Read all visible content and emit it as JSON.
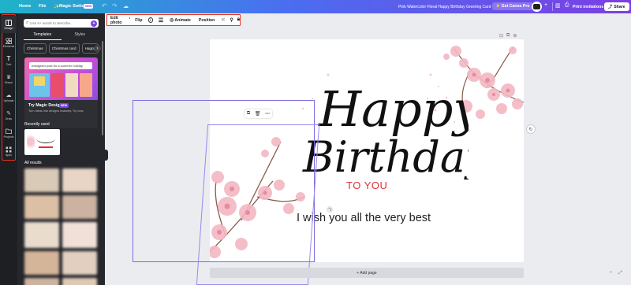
{
  "topbar": {
    "home_label": "Home",
    "file_label": "File",
    "magic_switch_label": "Magic Switch",
    "new_badge": "NEW",
    "doc_title": "Pink Watercolor Floral Happy Birthday Greeting Card",
    "get_pro_label": "Get Canva Pro",
    "print_label": "Print invitations",
    "share_label": "Share"
  },
  "rail": {
    "items": [
      {
        "label": "Design",
        "icon": "layout-icon"
      },
      {
        "label": "Elements",
        "icon": "shapes-icon"
      },
      {
        "label": "Text",
        "icon": "text-icon"
      },
      {
        "label": "Brand",
        "icon": "crown-icon"
      },
      {
        "label": "Uploads",
        "icon": "upload-icon"
      },
      {
        "label": "Draw",
        "icon": "pen-icon"
      },
      {
        "label": "Projects",
        "icon": "folder-icon"
      },
      {
        "label": "Apps",
        "icon": "apps-icon"
      }
    ]
  },
  "panel": {
    "search_placeholder": "Use 5+ words to describe...",
    "tab_templates": "Templates",
    "tab_styles": "Styles",
    "chips": [
      "Christmas",
      "Christmas card",
      "Happy"
    ],
    "promo_input": "Instagram post for a summer holiday",
    "promo_title": "Try Magic Design",
    "promo_badge": "NEW",
    "promo_desc": "Turn ideas into designs instantly. Try now.",
    "recently_used": "Recently used",
    "all_results": "All results"
  },
  "toolbar": {
    "edit_photo": "Edit photo",
    "flip": "Flip",
    "animate": "Animate",
    "position": "Position"
  },
  "canvas": {
    "happy": "Happy",
    "birthday": "Birthday",
    "to_you": "TO YOU",
    "wish": "I wish you all the very best",
    "add_page": "+ Add page"
  },
  "colors": {
    "accent_red": "#e8341f",
    "to_you_red": "#e0323a",
    "selection_purple": "#7e6be0",
    "blossom_pink": "#f3b8c4"
  }
}
